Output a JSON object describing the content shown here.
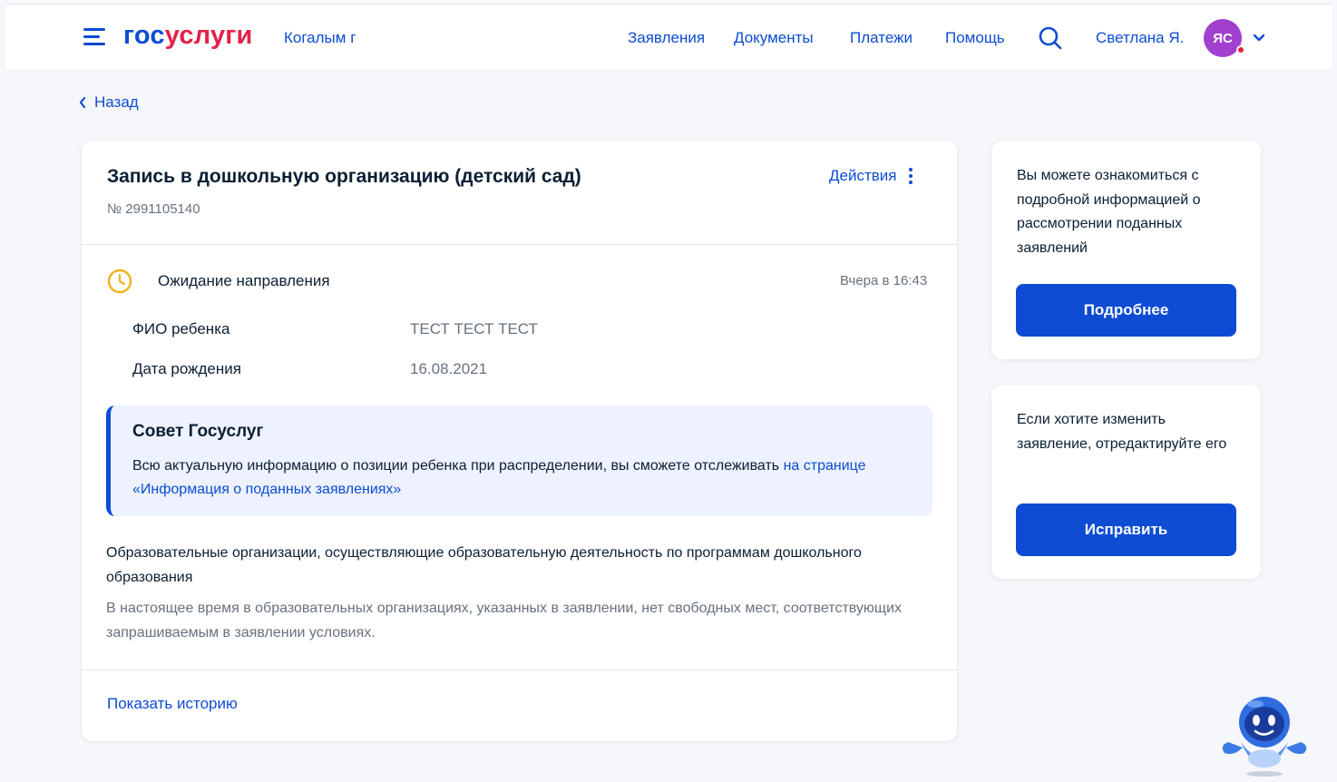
{
  "header": {
    "logo_part1": "гос",
    "logo_part2": "услуги",
    "city": "Когалым г",
    "nav": [
      "Заявления",
      "Документы",
      "Платежи",
      "Помощь"
    ],
    "user_name": "Светлана Я.",
    "avatar_initials": "ЯС"
  },
  "back_label": "Назад",
  "application": {
    "title": "Запись в дошкольную организацию (детский сад)",
    "number": "№ 2991105140",
    "actions_label": "Действия",
    "status": "Ожидание направления",
    "status_time": "Вчера в 16:43",
    "fields": [
      {
        "label": "ФИО ребенка",
        "value": "ТЕСТ ТЕСТ ТЕСТ"
      },
      {
        "label": "Дата рождения",
        "value": "16.08.2021"
      }
    ],
    "advice": {
      "title": "Совет Госуслуг",
      "text": "Всю актуальную информацию о позиции ребенка при распределении, вы сможете отслеживать ",
      "link": "на странице «Информация о поданных заявлениях»"
    },
    "org_title": "Образовательные организации, осуществляющие образовательную деятельность по программам дошкольного образования",
    "org_text": "В настоящее время в образовательных организациях, указанных в заявлении, нет свободных мест, соответствующих запрашиваемым в заявлении условиях.",
    "history_label": "Показать историю"
  },
  "side": {
    "info_text": "Вы можете ознакомиться с подробной информацией о рассмотрении поданных заявлений",
    "info_button": "Подробнее",
    "edit_text": "Если хотите изменить заявление, отредактируйте его",
    "edit_button": "Исправить"
  },
  "colors": {
    "accent": "#0d4cd3",
    "brand_red": "#e3224b",
    "avatar": "#a13fce",
    "status_clock": "#f4b21b",
    "advice_bg": "#edf2fe"
  },
  "icons": [
    "menu-icon",
    "search-icon",
    "chevron-down-icon",
    "chevron-left-icon",
    "kebab-icon",
    "clock-icon",
    "robot-assistant-icon"
  ]
}
